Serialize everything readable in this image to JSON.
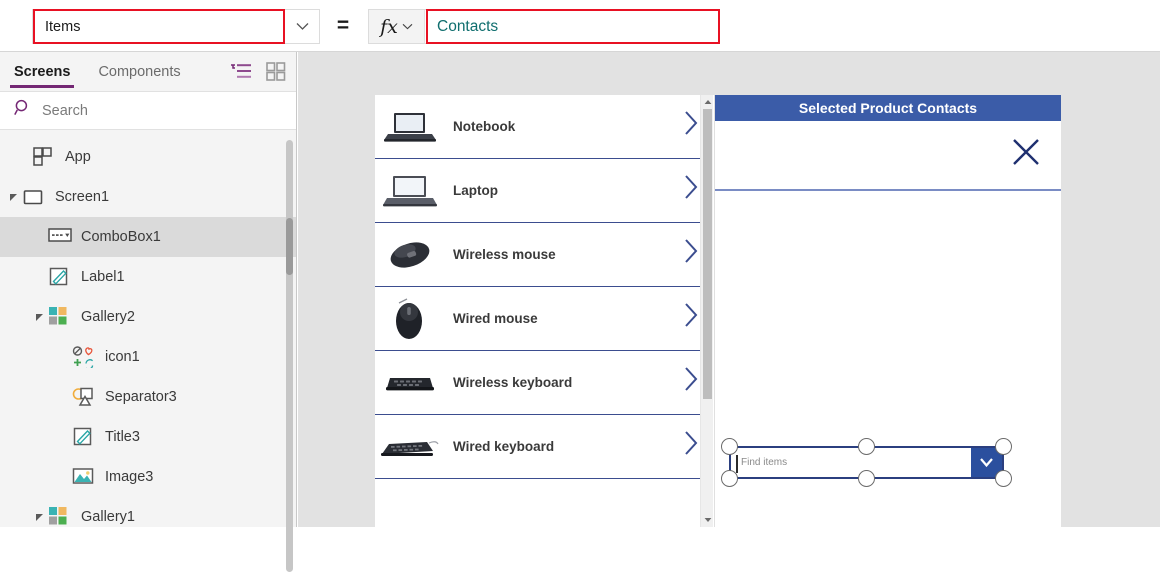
{
  "formula_bar": {
    "property_value": "Items",
    "equals": "=",
    "fx_label": "fx",
    "fx_chevron": "⌄",
    "prop_chevron": "⌄",
    "formula_value": "Contacts",
    "highlight_color": "#e81123",
    "formula_text_color": "#0f6e6e"
  },
  "sidebar": {
    "tabs": [
      {
        "label": "Screens",
        "active": true
      },
      {
        "label": "Components",
        "active": false
      }
    ],
    "tools": [
      {
        "name": "filter-list-icon",
        "color": "#742774"
      },
      {
        "name": "grid-view-icon",
        "color": "#8a8a8a"
      }
    ],
    "search": {
      "placeholder": "Search",
      "icon": "search-icon"
    },
    "accent_color": "#742774",
    "tree": [
      {
        "label": "App",
        "icon": "app-icon",
        "indent": 0,
        "caret": "",
        "selected": false
      },
      {
        "label": "Screen1",
        "icon": "screen-icon",
        "indent": 0,
        "caret": "▸",
        "selected": false
      },
      {
        "label": "ComboBox1",
        "icon": "combobox-icon",
        "indent": 1,
        "caret": "",
        "selected": true
      },
      {
        "label": "Label1",
        "icon": "label-icon",
        "indent": 1,
        "caret": "",
        "selected": false
      },
      {
        "label": "Gallery2",
        "icon": "gallery-icon",
        "indent": 1,
        "caret": "▸",
        "selected": false
      },
      {
        "label": "icon1",
        "icon": "icons-icon",
        "indent": 2,
        "caret": "",
        "selected": false
      },
      {
        "label": "Separator3",
        "icon": "shapes-icon",
        "indent": 2,
        "caret": "",
        "selected": false
      },
      {
        "label": "Title3",
        "icon": "label-icon",
        "indent": 2,
        "caret": "",
        "selected": false
      },
      {
        "label": "Image3",
        "icon": "image-icon",
        "indent": 2,
        "caret": "",
        "selected": false
      },
      {
        "label": "Gallery1",
        "icon": "gallery-icon",
        "indent": 1,
        "caret": "▸",
        "selected": false
      }
    ]
  },
  "canvas": {
    "gallery": {
      "items": [
        {
          "title": "Notebook",
          "thumb": "notebook-thumb"
        },
        {
          "title": "Laptop",
          "thumb": "laptop-thumb"
        },
        {
          "title": "Wireless mouse",
          "thumb": "wireless-mouse-thumb"
        },
        {
          "title": "Wired mouse",
          "thumb": "wired-mouse-thumb"
        },
        {
          "title": "Wireless keyboard",
          "thumb": "wireless-keyboard-thumb"
        },
        {
          "title": "Wired keyboard",
          "thumb": "wired-keyboard-thumb"
        }
      ],
      "chevron": "›",
      "accent_color": "#3b4d8f"
    },
    "panel": {
      "title": "Selected Product Contacts",
      "header_color": "#3b5ca8",
      "close_icon": "close-icon"
    },
    "combobox": {
      "placeholder": "Find items",
      "dropdown_icon": "chevron-down-icon",
      "border_color": "#2b3f7f",
      "dropdown_color": "#2b4f9e",
      "selected": true
    }
  }
}
